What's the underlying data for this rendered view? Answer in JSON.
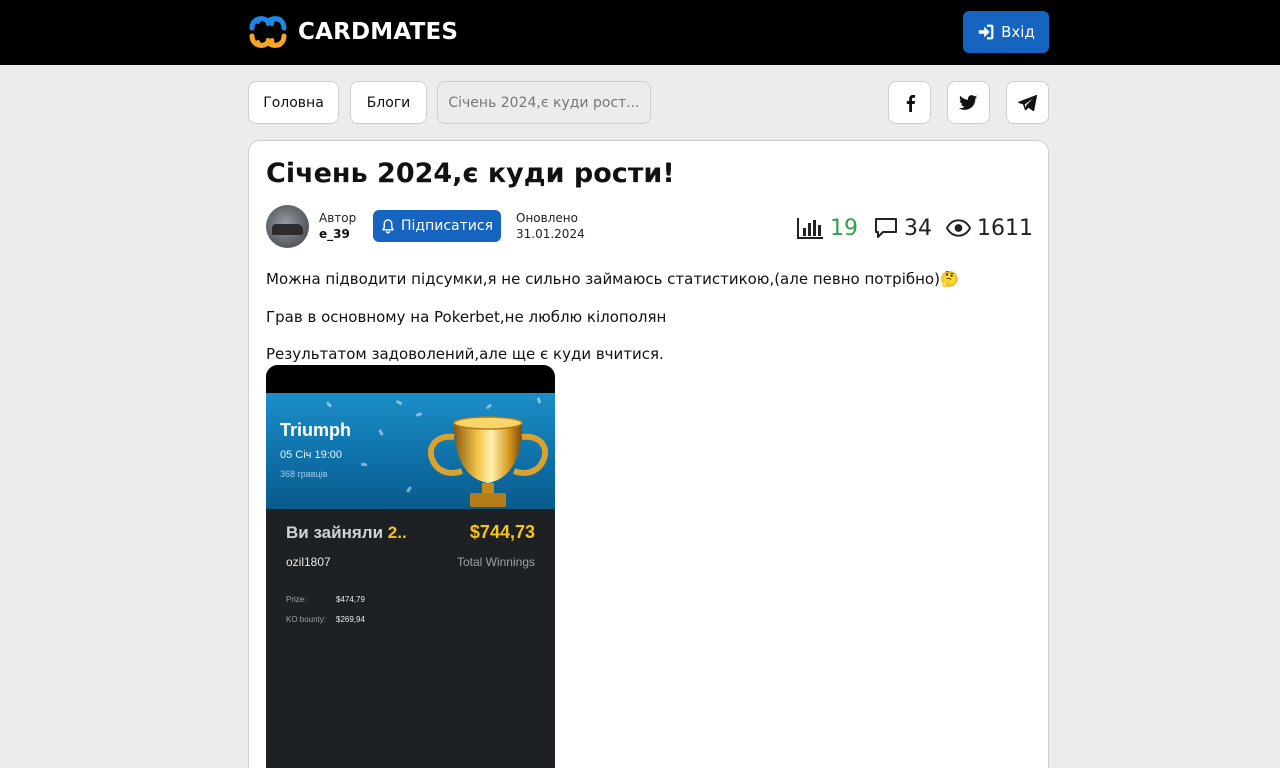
{
  "header": {
    "brand": "CARDMATES",
    "login_label": "Вхід",
    "colors": {
      "background": "#000000",
      "brand_orange": "#f5a623",
      "brand_blue": "#1e88e5",
      "accent": "#1565c0"
    }
  },
  "breadcrumb": {
    "items": [
      {
        "label": "Головна"
      },
      {
        "label": "Блоги"
      },
      {
        "label": "Січень 2024,є куди рост..."
      }
    ]
  },
  "share": {
    "icons": [
      "facebook-icon",
      "twitter-icon",
      "telegram-icon"
    ]
  },
  "article": {
    "title": "Січень 2024,є куди рости!",
    "author_label": "Автор",
    "author_name": "e_39",
    "subscribe_label": "Підписатися",
    "updated_label": "Оновлено",
    "updated_date": "31.01.2024",
    "stats": {
      "rating": "19",
      "comments": "34",
      "views": "1611",
      "rating_color": "#2e9e4f"
    },
    "paragraphs": [
      "Можна підводити підсумки,я не сильно займаюсь статистикою,(але певно потрібно)🤔",
      "Грав в основному на Pokerbet,не люблю кілополян",
      "Результатом задоволений,але ще є куди вчитися."
    ],
    "screenshot": {
      "tournament": "Triumph",
      "date": "05 Січ 19:00",
      "players": "368 гравців",
      "result_prefix": "Ви зайняли",
      "place": "2..",
      "total_amount": "$744,73",
      "nickname": "ozil1807",
      "total_label": "Total Winnings",
      "prize_label": "Prize:",
      "prize_value": "$474,79",
      "bounty_label": "KO bounty:",
      "bounty_value": "$269,94"
    }
  }
}
